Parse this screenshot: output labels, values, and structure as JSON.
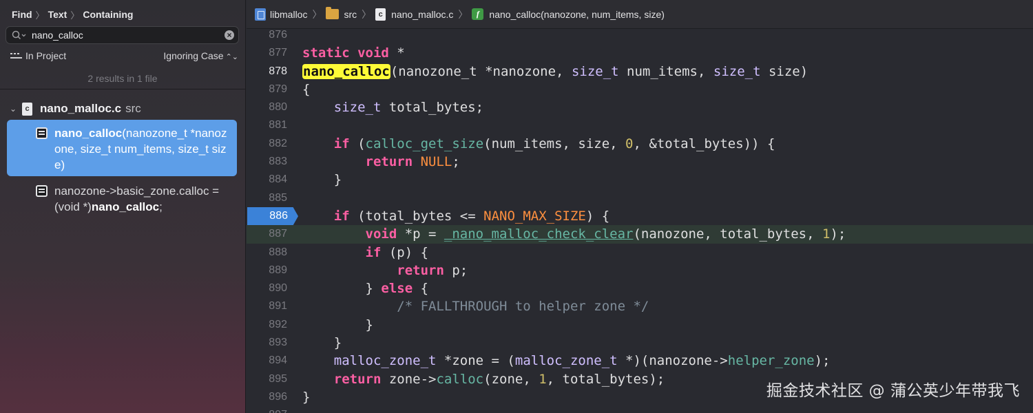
{
  "sidebar": {
    "breadcrumb": [
      "Find",
      "Text",
      "Containing"
    ],
    "search": {
      "value": "nano_calloc",
      "search_icon": "magnifier-icon",
      "clear_icon": "clear-icon"
    },
    "scope": "In Project",
    "case_mode": "Ignoring Case",
    "results_summary": "2 results in 1 file",
    "file": {
      "name": "nano_malloc.c",
      "dir": "src",
      "icon_letter": "c"
    },
    "results": [
      {
        "match": "nano_calloc",
        "after": "(nanozone_t *nanozone, size_t num_items, size_t size)",
        "selected": true
      },
      {
        "before": "nanozone->basic_zone.calloc = (void *)",
        "match": "nano_calloc",
        "after": ";",
        "selected": false
      }
    ]
  },
  "editor": {
    "jumpbar": {
      "project": "libmalloc",
      "folder": "src",
      "file": "nano_malloc.c",
      "file_icon_letter": "c",
      "function": "nano_calloc(nanozone, num_items, size)",
      "function_icon_letter": "f"
    },
    "breakpoint_line": "886",
    "current_line": "887",
    "colors": {
      "keyword": "#fc5fa3",
      "type": "#d0bfff",
      "function": "#67b7a4",
      "macro": "#fd8f3f",
      "number": "#d0bf69",
      "comment": "#7f8c98",
      "highlight": "#fefb37",
      "breakpoint": "#3b82d8",
      "selection": "#5d9ee8"
    },
    "lines": [
      {
        "n": "876",
        "tokens": []
      },
      {
        "n": "877",
        "tokens": [
          [
            "kw",
            "static"
          ],
          [
            "t",
            " "
          ],
          [
            "kw",
            "void"
          ],
          [
            "t",
            " *"
          ]
        ]
      },
      {
        "n": "878",
        "tokens": [
          [
            "hl",
            "nano_calloc"
          ],
          [
            "t",
            "(nanozone_t *nanozone, "
          ],
          [
            "typ",
            "size_t"
          ],
          [
            "t",
            " num_items, "
          ],
          [
            "typ",
            "size_t"
          ],
          [
            "t",
            " size)"
          ]
        ]
      },
      {
        "n": "879",
        "tokens": [
          [
            "t",
            "{"
          ]
        ]
      },
      {
        "n": "880",
        "tokens": [
          [
            "t",
            "    "
          ],
          [
            "typ",
            "size_t"
          ],
          [
            "t",
            " total_bytes;"
          ]
        ]
      },
      {
        "n": "881",
        "tokens": []
      },
      {
        "n": "882",
        "tokens": [
          [
            "t",
            "    "
          ],
          [
            "kw",
            "if"
          ],
          [
            "t",
            " ("
          ],
          [
            "fn",
            "calloc_get_size"
          ],
          [
            "t",
            "(num_items, size, "
          ],
          [
            "num",
            "0"
          ],
          [
            "t",
            ", &total_bytes)) {"
          ]
        ]
      },
      {
        "n": "883",
        "tokens": [
          [
            "t",
            "        "
          ],
          [
            "kw",
            "return"
          ],
          [
            "t",
            " "
          ],
          [
            "mac",
            "NULL"
          ],
          [
            "t",
            ";"
          ]
        ]
      },
      {
        "n": "884",
        "tokens": [
          [
            "t",
            "    }"
          ]
        ]
      },
      {
        "n": "885",
        "tokens": []
      },
      {
        "n": "886",
        "tokens": [
          [
            "t",
            "    "
          ],
          [
            "kw",
            "if"
          ],
          [
            "t",
            " (total_bytes <= "
          ],
          [
            "mac",
            "NANO_MAX_SIZE"
          ],
          [
            "t",
            ") {"
          ]
        ]
      },
      {
        "n": "887",
        "tokens": [
          [
            "t",
            "        "
          ],
          [
            "kw",
            "void"
          ],
          [
            "t",
            " *p = "
          ],
          [
            "fnu",
            "_nano_malloc_check_clear"
          ],
          [
            "t",
            "(nanozone, total_bytes, "
          ],
          [
            "num",
            "1"
          ],
          [
            "t",
            ");"
          ]
        ]
      },
      {
        "n": "888",
        "tokens": [
          [
            "t",
            "        "
          ],
          [
            "kw",
            "if"
          ],
          [
            "t",
            " (p) {"
          ]
        ]
      },
      {
        "n": "889",
        "tokens": [
          [
            "t",
            "            "
          ],
          [
            "kw",
            "return"
          ],
          [
            "t",
            " p;"
          ]
        ]
      },
      {
        "n": "890",
        "tokens": [
          [
            "t",
            "        } "
          ],
          [
            "kw",
            "else"
          ],
          [
            "t",
            " {"
          ]
        ]
      },
      {
        "n": "891",
        "tokens": [
          [
            "t",
            "            "
          ],
          [
            "cmt",
            "/* FALLTHROUGH to helper zone */"
          ]
        ]
      },
      {
        "n": "892",
        "tokens": [
          [
            "t",
            "        }"
          ]
        ]
      },
      {
        "n": "893",
        "tokens": [
          [
            "t",
            "    }"
          ]
        ]
      },
      {
        "n": "894",
        "tokens": [
          [
            "t",
            "    "
          ],
          [
            "typ",
            "malloc_zone_t"
          ],
          [
            "t",
            " *zone = ("
          ],
          [
            "typ",
            "malloc_zone_t"
          ],
          [
            "t",
            " *)(nanozone->"
          ],
          [
            "fn",
            "helper_zone"
          ],
          [
            "t",
            ");"
          ]
        ]
      },
      {
        "n": "895",
        "tokens": [
          [
            "t",
            "    "
          ],
          [
            "kw",
            "return"
          ],
          [
            "t",
            " zone->"
          ],
          [
            "fn",
            "calloc"
          ],
          [
            "t",
            "(zone, "
          ],
          [
            "num",
            "1"
          ],
          [
            "t",
            ", total_bytes);"
          ]
        ]
      },
      {
        "n": "896",
        "tokens": [
          [
            "t",
            "}"
          ]
        ]
      },
      {
        "n": "897",
        "tokens": []
      }
    ]
  },
  "watermark": "掘金技术社区 @ 蒲公英少年带我飞"
}
